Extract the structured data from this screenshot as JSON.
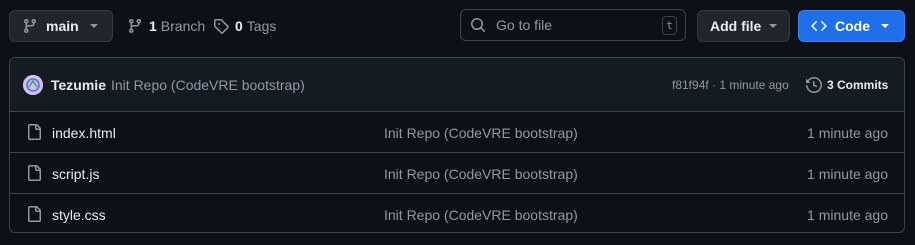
{
  "toolbar": {
    "branch_label": "main",
    "branches_count": "1",
    "branches_label": "Branch",
    "tags_count": "0",
    "tags_label": "Tags",
    "search_placeholder": "Go to file",
    "search_shortcut": "t",
    "add_file_label": "Add file",
    "code_label": "Code"
  },
  "latest_commit": {
    "author": "Tezumie",
    "message": "Init Repo (CodeVRE bootstrap)",
    "hash_and_time": "f81f94f · 1 minute ago",
    "commits_label": "3 Commits"
  },
  "files": [
    {
      "name": "index.html",
      "message": "Init Repo (CodeVRE bootstrap)",
      "age": "1 minute ago"
    },
    {
      "name": "script.js",
      "message": "Init Repo (CodeVRE bootstrap)",
      "age": "1 minute ago"
    },
    {
      "name": "style.css",
      "message": "Init Repo (CodeVRE bootstrap)",
      "age": "1 minute ago"
    }
  ],
  "colors": {
    "background": "#0d1117",
    "primary_button": "#1f6feb",
    "border": "#3d444d",
    "muted_text": "#9198a1"
  }
}
